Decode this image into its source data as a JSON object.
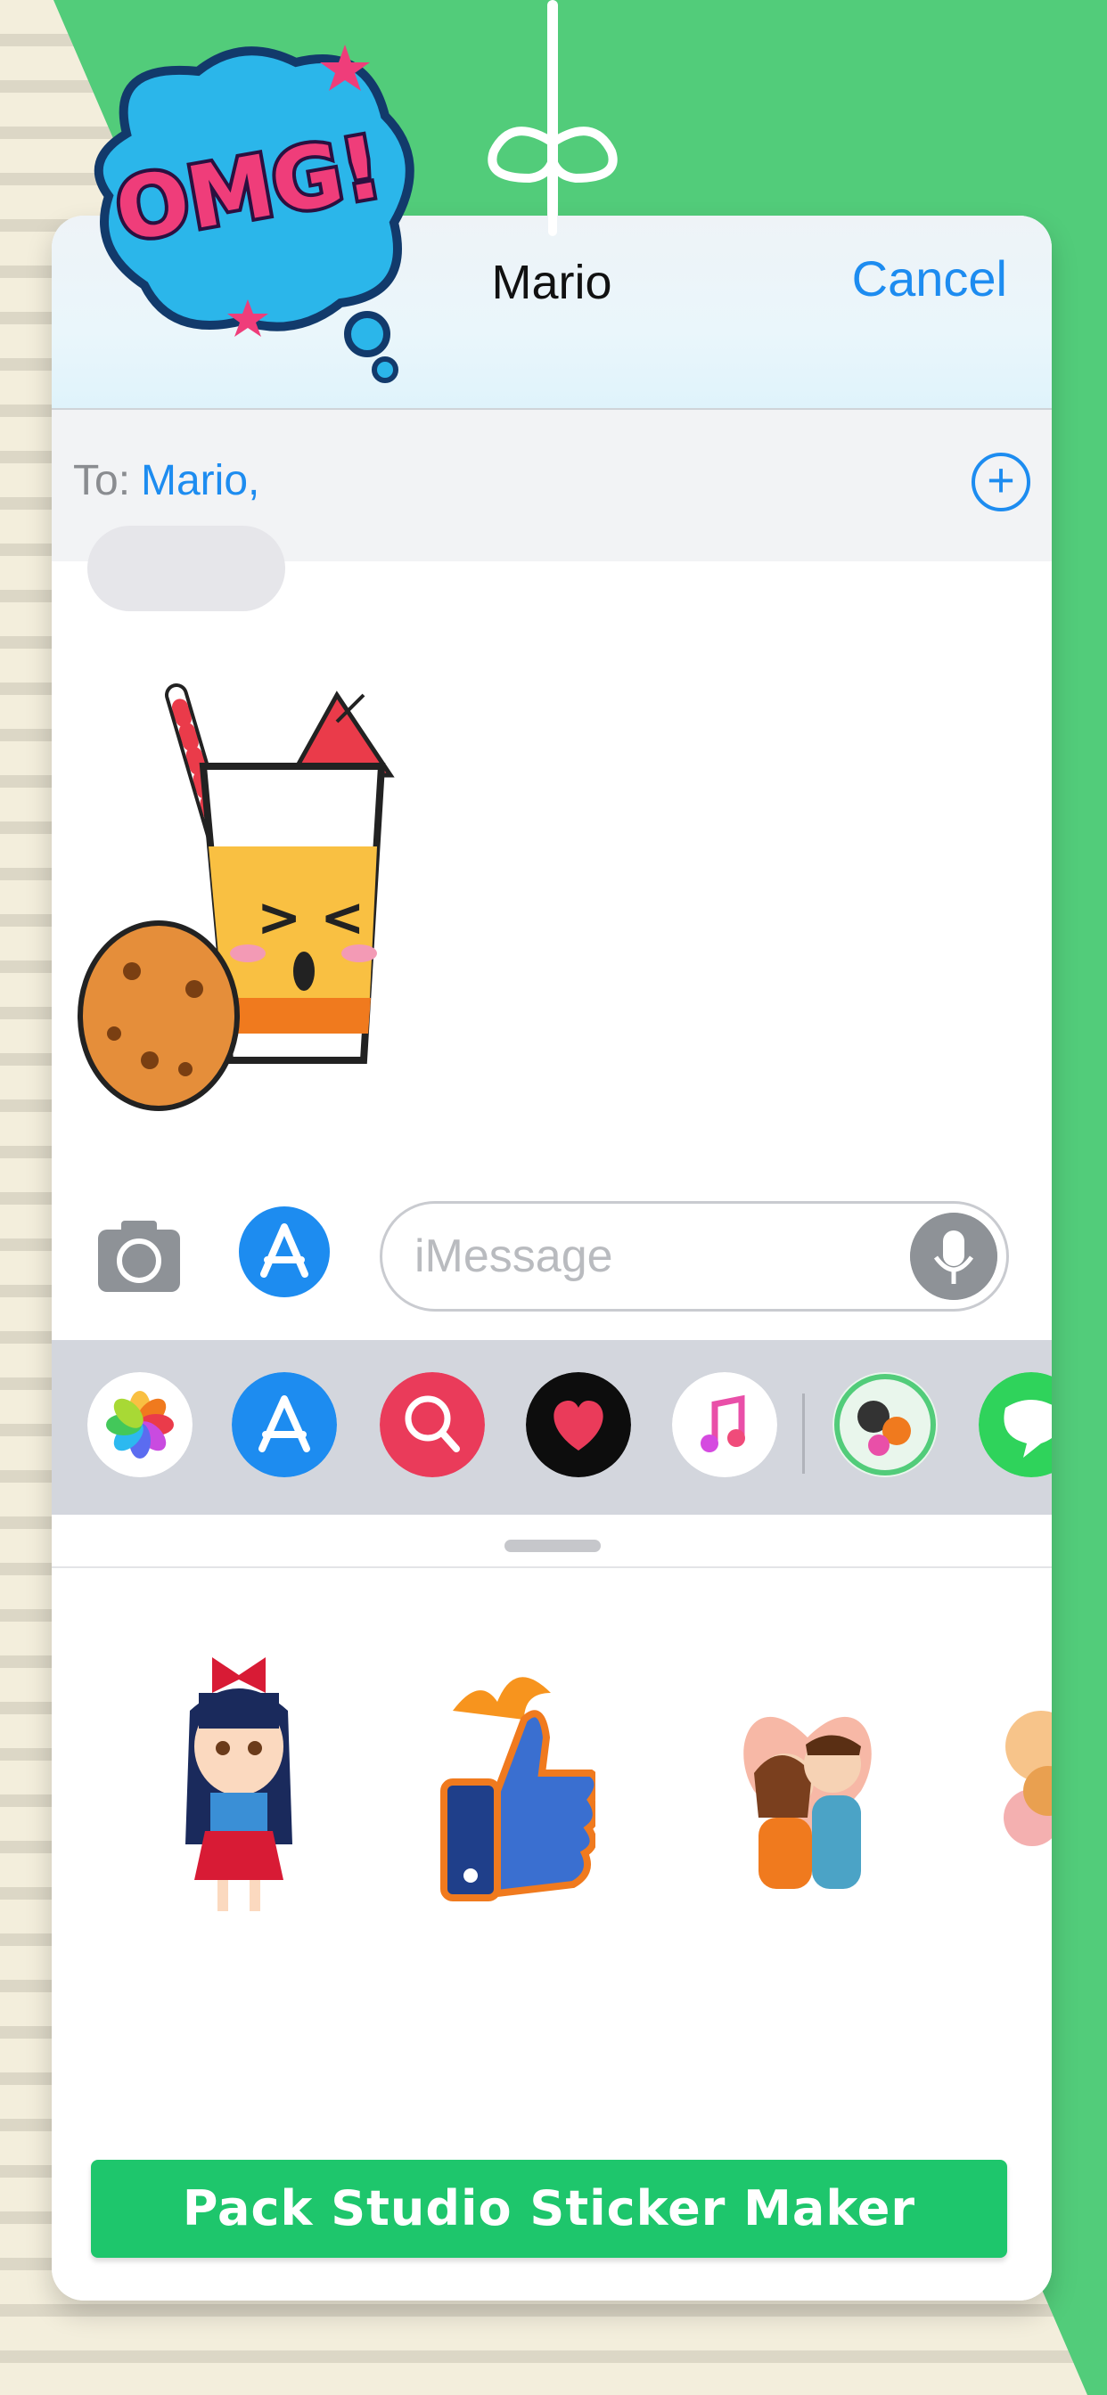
{
  "colors": {
    "accent": "#1d8cf0",
    "background_green": "#52cc7a",
    "cta_green": "#1ec66c"
  },
  "decoration": {
    "omg_sticker_text": "OMG!"
  },
  "header": {
    "title": "Mario",
    "cancel_label": "Cancel"
  },
  "recipient": {
    "label": "To:",
    "value": "Mario,"
  },
  "compose": {
    "placeholder": "iMessage",
    "icons": [
      "camera-icon",
      "app-store-icon",
      "microphone-icon"
    ]
  },
  "app_drawer": {
    "apps": [
      "photos-app-icon",
      "app-store-app-icon",
      "web-search-app-icon",
      "heart-app-icon",
      "music-app-icon",
      "sticker-pack-app-icon",
      "messages-app-icon"
    ]
  },
  "sticker_panel": {
    "stickers": [
      "girl-sticker",
      "thumbs-up-sticker",
      "couple-sticker",
      "partial-sticker"
    ],
    "cta_label": "Pack Studio Sticker Maker"
  }
}
